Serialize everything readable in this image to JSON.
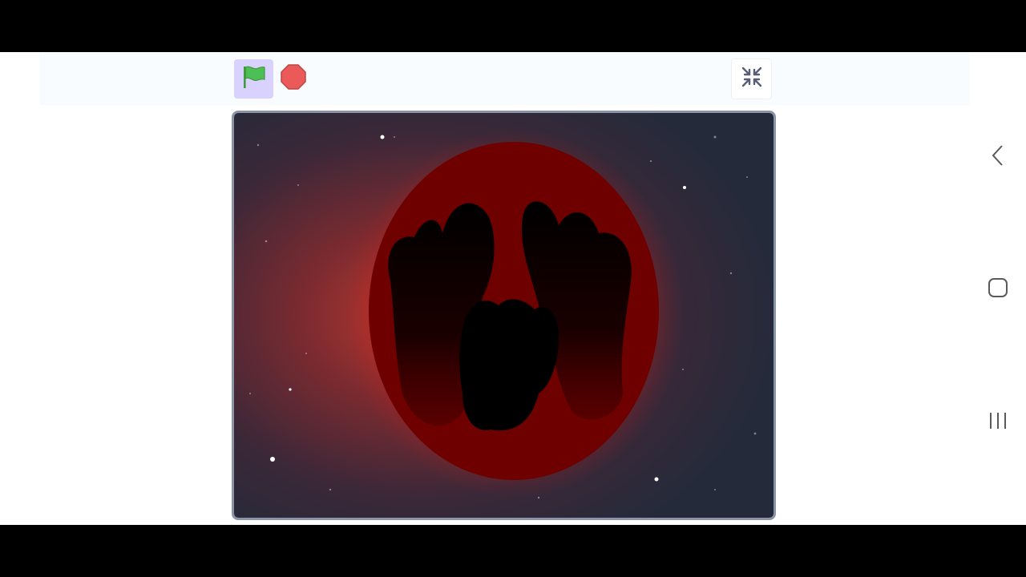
{
  "toolbar": {
    "green_flag_icon": "green-flag-icon",
    "stop_icon": "stop-sign-icon",
    "fullscreen_icon": "exit-fullscreen-icon"
  },
  "colors": {
    "flag_bg": "#d9d2ff",
    "flag_green": "#4cbf56",
    "stop_red": "#ec5959",
    "stage_border": "#8a94a6",
    "orb_red": "#6e0000"
  },
  "navigation": {
    "back_icon": "back-icon",
    "home_icon": "home-icon",
    "recents_icon": "recents-icon"
  }
}
